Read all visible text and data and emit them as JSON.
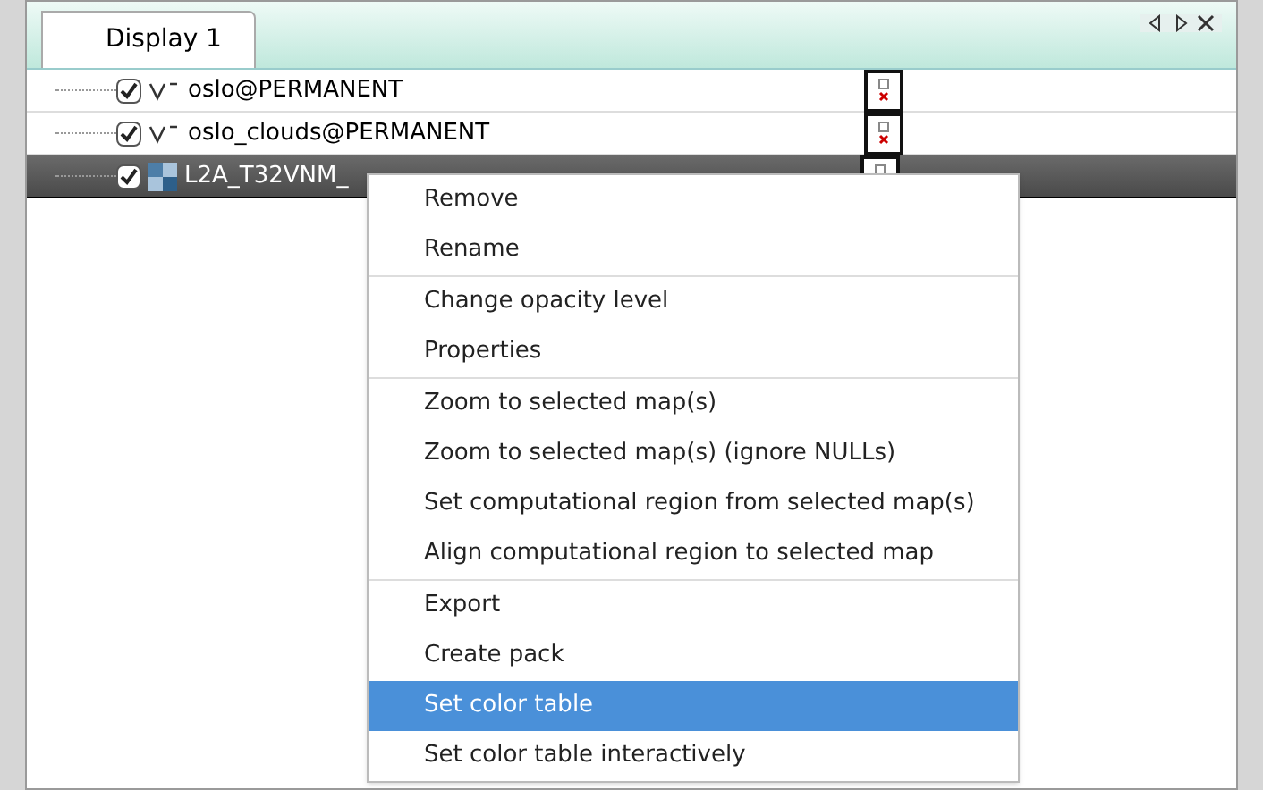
{
  "tabs": [
    {
      "label": "Display 1",
      "selected": true
    }
  ],
  "layers": [
    {
      "name": "oslo@PERMANENT",
      "kind": "vector",
      "checked": true,
      "selected": false
    },
    {
      "name": "oslo_clouds@PERMANENT",
      "kind": "vector",
      "checked": true,
      "selected": false
    },
    {
      "name": "L2A_T32VNM_",
      "kind": "raster",
      "checked": true,
      "selected": true
    }
  ],
  "context_menu": {
    "groups": [
      [
        {
          "label": "Remove",
          "selected": false
        },
        {
          "label": "Rename",
          "selected": false
        }
      ],
      [
        {
          "label": "Change opacity level",
          "selected": false
        },
        {
          "label": "Properties",
          "selected": false
        }
      ],
      [
        {
          "label": "Zoom to selected map(s)",
          "selected": false
        },
        {
          "label": "Zoom to selected map(s) (ignore NULLs)",
          "selected": false
        },
        {
          "label": "Set computational region from selected map(s)",
          "selected": false
        },
        {
          "label": "Align computational region to selected map",
          "selected": false
        }
      ],
      [
        {
          "label": "Export",
          "selected": false
        },
        {
          "label": "Create pack",
          "selected": false
        },
        {
          "label": "Set color table",
          "selected": true
        },
        {
          "label": "Set color table interactively",
          "selected": false
        }
      ]
    ]
  }
}
